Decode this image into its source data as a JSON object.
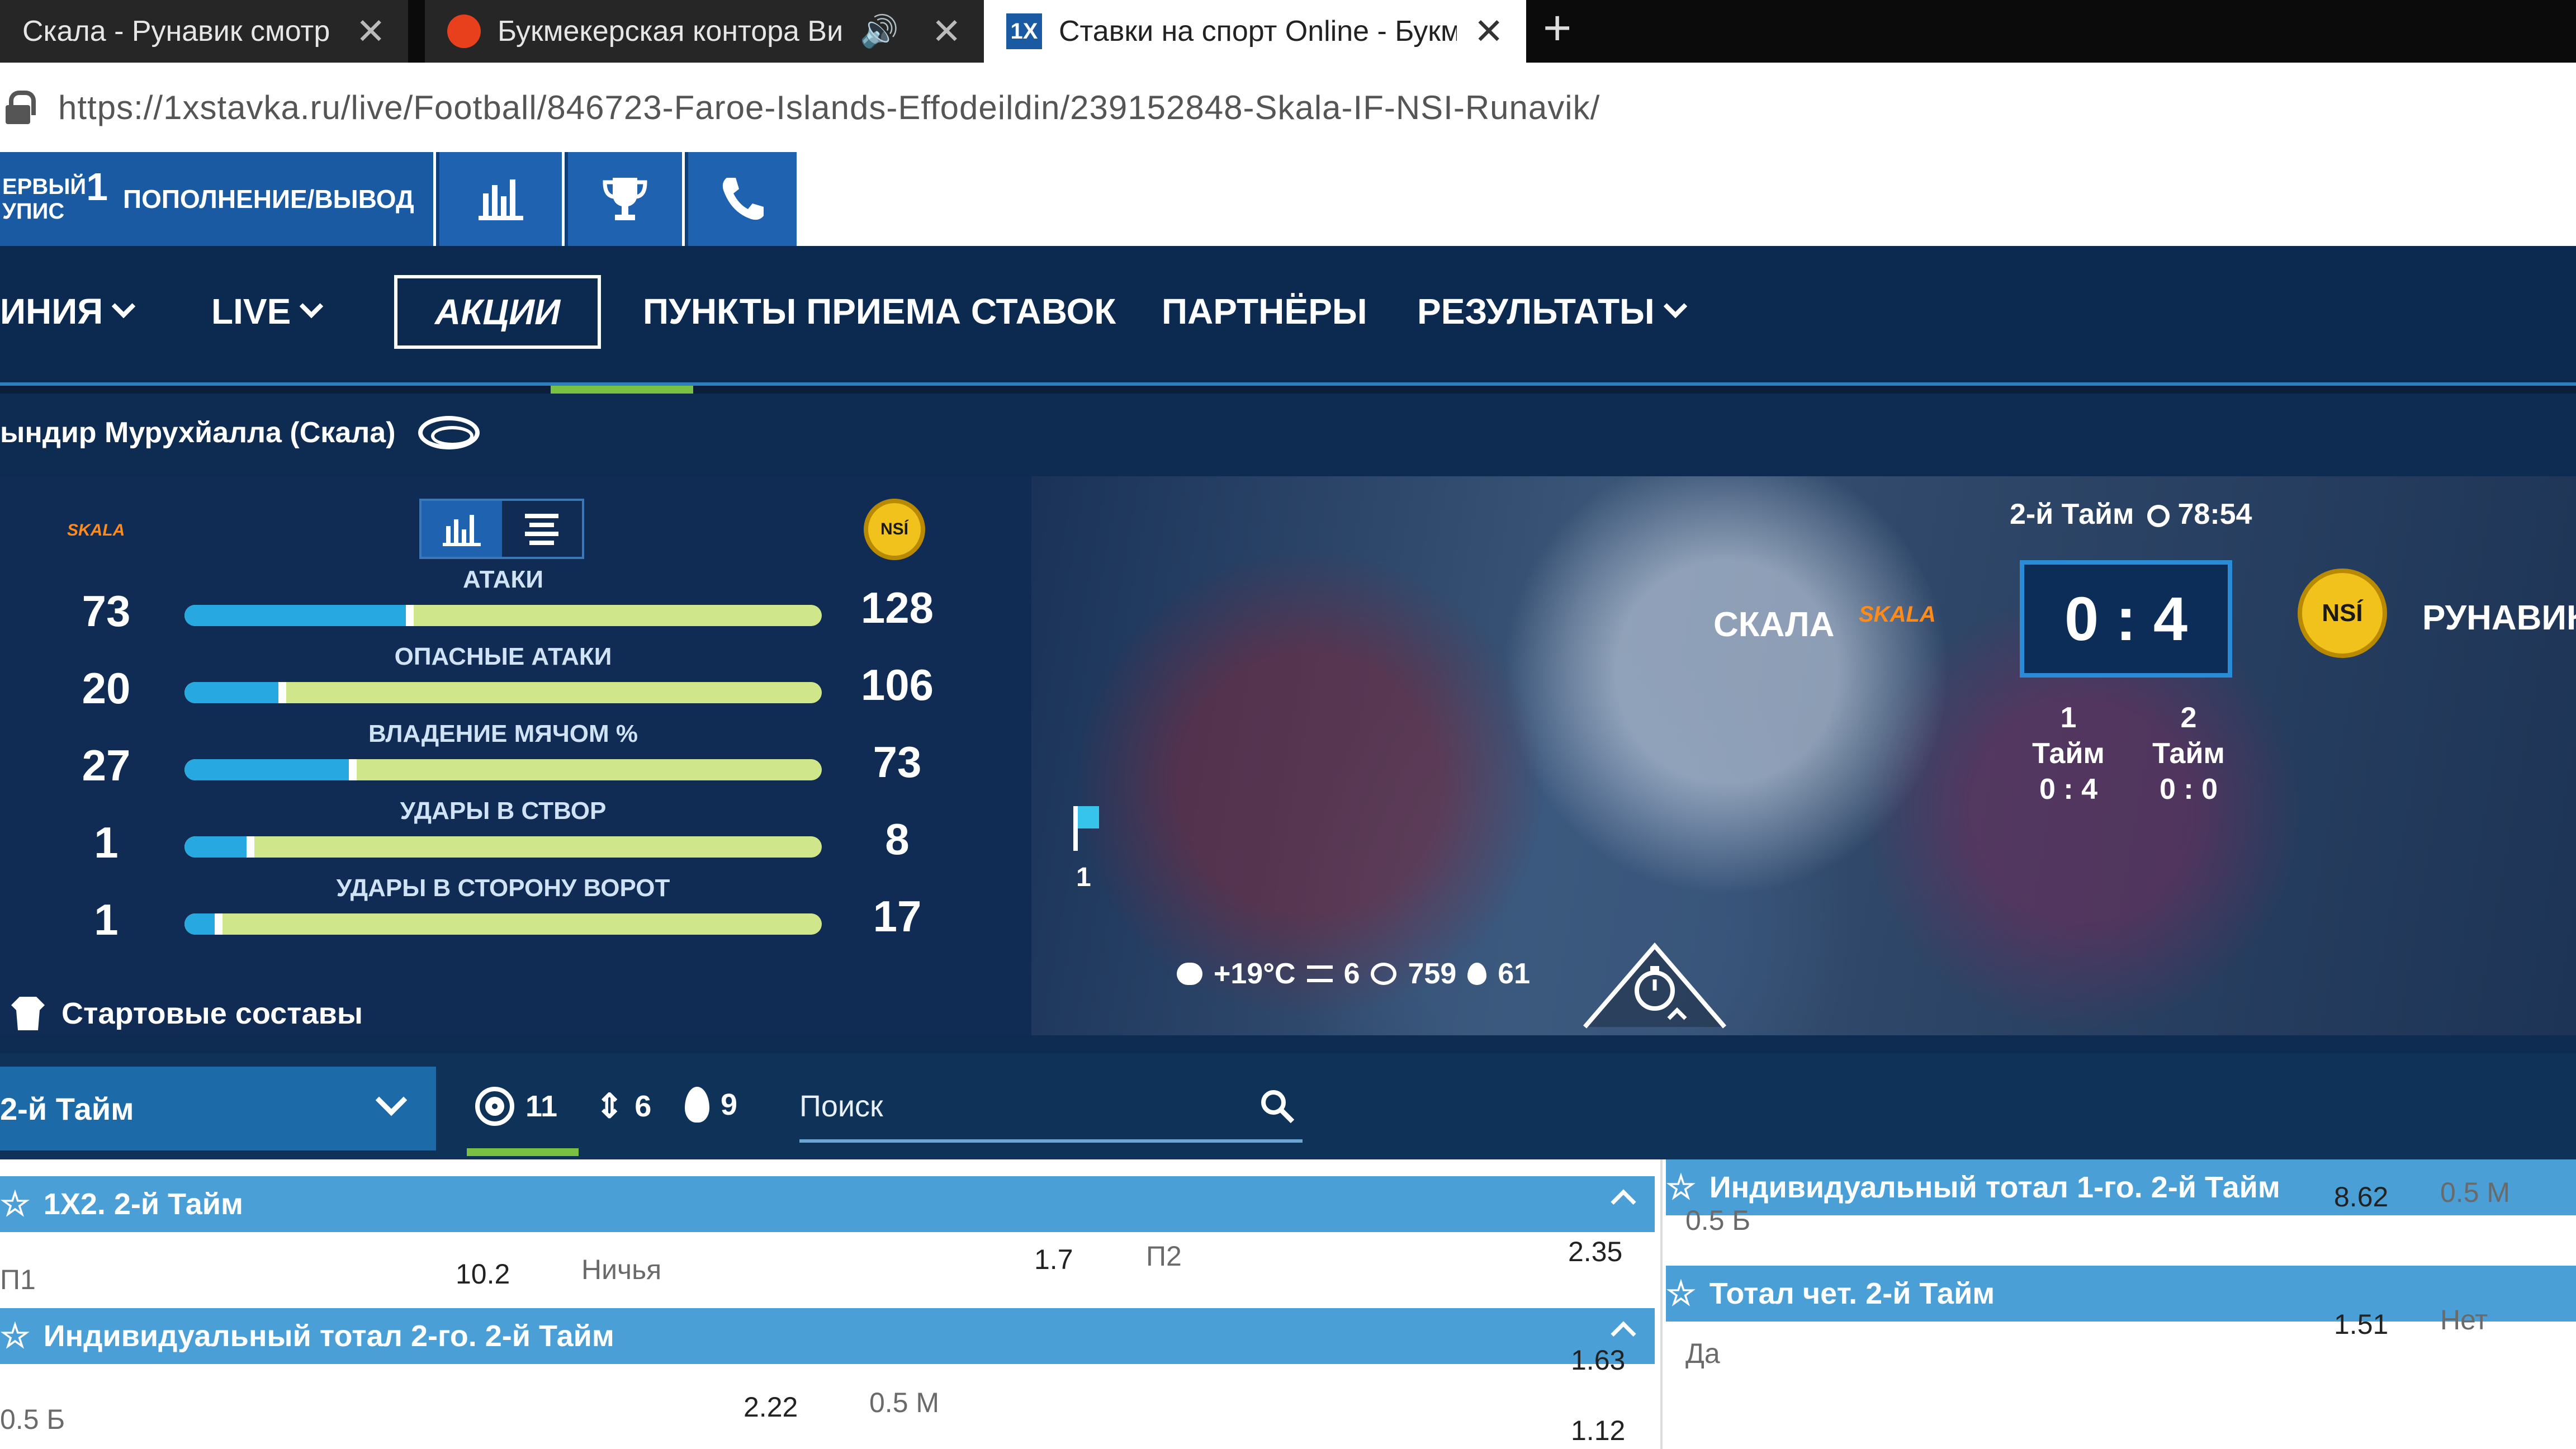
{
  "browser": {
    "tabs": [
      {
        "title": "Скала - Рунавик смотр",
        "close": "✕"
      },
      {
        "title": "Букмекерская контора Ви",
        "close": "✕"
      },
      {
        "title": "Ставки на спорт Online - Букм",
        "close": "✕"
      }
    ],
    "new_tab": "+",
    "url": "https://1xstavka.ru/live/Football/846723-Faroe-Islands-Effodeildin/239152848-Skala-IF-NSI-Runavik/"
  },
  "header": {
    "first_deposit_line1": "ЕРВЫЙ",
    "first_deposit_line2": "УПИС",
    "first_deposit_num": "1",
    "deposit_withdraw": "ПОПОЛНЕНИЕ/ВЫВОД",
    "icons": [
      "stats-icon",
      "trophy-icon",
      "phone-icon"
    ]
  },
  "nav": {
    "items": [
      {
        "label": "ИНИЯ",
        "has_dropdown": true
      },
      {
        "label": "LIVE",
        "has_dropdown": true
      },
      {
        "label": "АКЦИИ",
        "has_dropdown": false
      },
      {
        "label": "ПУНКТЫ ПРИЕМА СТАВОК",
        "has_dropdown": false
      },
      {
        "label": "ПАРТНЁРЫ",
        "has_dropdown": false
      },
      {
        "label": "РЕЗУЛЬТАТЫ",
        "has_dropdown": true
      }
    ]
  },
  "match": {
    "stadium": "ындир Мурухйалла (Скала)",
    "home": {
      "name": "СКАЛА",
      "logo_text": "SKALA"
    },
    "away": {
      "name": "РУНАВИК",
      "logo_text": "NSÍ"
    },
    "period": "2-й Тайм",
    "time": "78:54",
    "score": "0 : 4",
    "halves": [
      {
        "label": "1 Тайм",
        "score": "0 : 4"
      },
      {
        "label": "2 Тайм",
        "score": "0 : 0"
      }
    ],
    "flag_count": "1",
    "weather": {
      "temperature": "+19°C",
      "wind": "6",
      "pressure": "759",
      "humidity": "61"
    },
    "stats": [
      {
        "label": "АТАКИ",
        "home": "73",
        "away": "128",
        "home_share": 0.36
      },
      {
        "label": "ОПАСНЫЕ АТАКИ",
        "home": "20",
        "away": "106",
        "home_share": 0.16
      },
      {
        "label": "ВЛАДЕНИЕ МЯЧОМ %",
        "home": "27",
        "away": "73",
        "home_share": 0.27
      },
      {
        "label": "УДАРЫ В СТВОР",
        "home": "1",
        "away": "8",
        "home_share": 0.11
      },
      {
        "label": "УДАРЫ В СТОРОНУ ВОРОТ",
        "home": "1",
        "away": "17",
        "home_share": 0.06
      }
    ],
    "lineups": "Стартовые составы"
  },
  "filters": {
    "period": "2-й Тайм",
    "counts": {
      "markets": "11",
      "changes": "6",
      "popular": "9"
    },
    "search_placeholder": "Поиск"
  },
  "markets": {
    "m1x2": {
      "title": "1X2. 2-й Тайм",
      "p1_label": "П1",
      "p1_odds": "10.2",
      "draw_label": "Ничья",
      "draw_odds": "1.7",
      "p2_label": "П2",
      "p2_odds": "2.35"
    },
    "ind_total_2": {
      "title": "Индивидуальный тотал 2-го. 2-й Тайм",
      "over_label": "0.5 Б",
      "over_odds": "2.22",
      "under_label": "0.5 М",
      "under_odds": "1.63",
      "extra_odds": "1.12"
    },
    "ind_total_1": {
      "title": "Индивидуальный тотал 1-го. 2-й Тайм",
      "over_label": "0.5 Б",
      "over_odds": "8.62",
      "under_label": "0.5 М"
    },
    "total_even": {
      "title": "Тотал чет. 2-й Тайм",
      "yes_label": "Да",
      "yes_odds": "1.51",
      "no_label": "Нет"
    }
  },
  "colors": {
    "nav_bg": "#0c2950",
    "header_blue": "#1a5aa3",
    "market_header": "#4aa0d6",
    "accent_green": "#79c142",
    "bar_home": "#27a8e0",
    "bar_away": "#cfe68a"
  }
}
